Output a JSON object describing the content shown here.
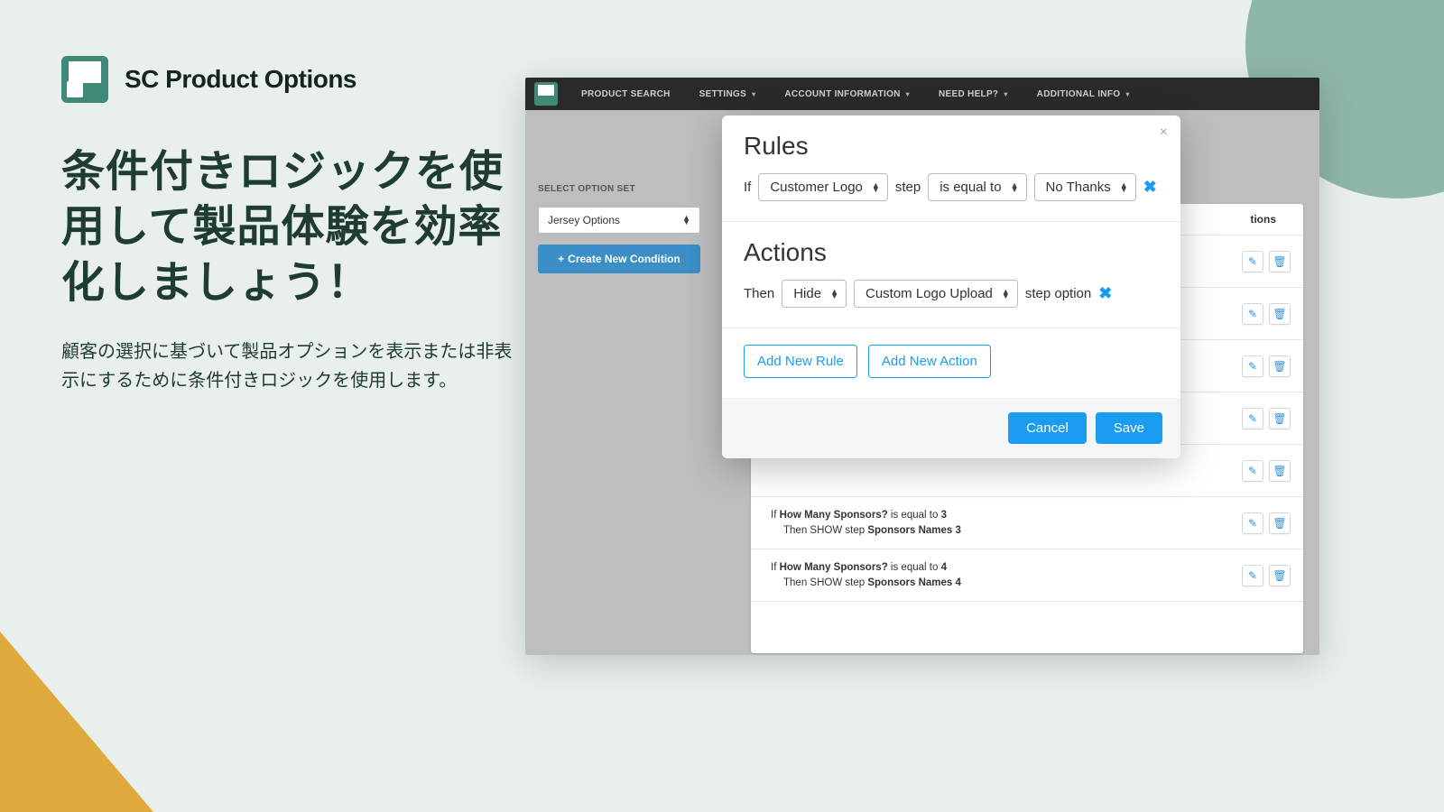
{
  "brand": {
    "name": "SC Product Options"
  },
  "headline": "条件付きロジックを使用して製品体験を効率化しましょう！",
  "subhead": "顧客の選択に基づいて製品オプションを表示または非表示にするために条件付きロジックを使用します。",
  "topnav": {
    "items": [
      {
        "label": "PRODUCT SEARCH",
        "dropdown": false
      },
      {
        "label": "SETTINGS",
        "dropdown": true
      },
      {
        "label": "ACCOUNT INFORMATION",
        "dropdown": true
      },
      {
        "label": "NEED HELP?",
        "dropdown": true
      },
      {
        "label": "ADDITIONAL INFO",
        "dropdown": true
      }
    ]
  },
  "sidebar": {
    "label": "SELECT OPTION SET",
    "selected": "Jersey Options",
    "create_label": "Create New Condition"
  },
  "bglist": {
    "actions_header": "tions",
    "rows": [
      {
        "if_field": "How Many Sponsors?",
        "rel": "is equal to",
        "val": "3",
        "then_verb": "SHOW",
        "then_target": "Sponsors Names 3"
      },
      {
        "if_field": "How Many Sponsors?",
        "rel": "is equal to",
        "val": "4",
        "then_verb": "SHOW",
        "then_target": "Sponsors Names 4"
      }
    ]
  },
  "modal": {
    "rules_title": "Rules",
    "if_label": "If",
    "field_value": "Customer Logo",
    "step_label": "step",
    "relation_value": "is equal to",
    "compare_value": "No Thanks",
    "actions_title": "Actions",
    "then_label": "Then",
    "verb_value": "Hide",
    "target_value": "Custom Logo Upload",
    "suffix_label": "step option",
    "add_rule": "Add New Rule",
    "add_action": "Add New Action",
    "cancel": "Cancel",
    "save": "Save"
  }
}
